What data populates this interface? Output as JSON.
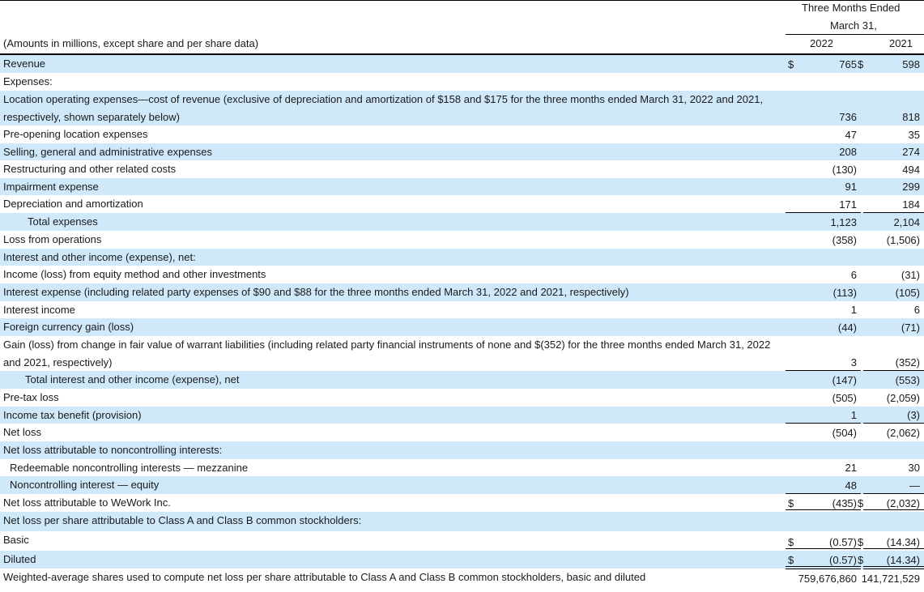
{
  "header": {
    "period_line1": "Three Months Ended",
    "period_line2": "March 31,",
    "col_2022": "2022",
    "col_2021": "2021",
    "amounts_note": "(Amounts in millions, except share and per share data)"
  },
  "rows": [
    {
      "label": "Revenue",
      "shaded": true,
      "h": 22,
      "d1": "$",
      "v2022": "765",
      "d2": "$",
      "v2021": "598"
    },
    {
      "label": "Expenses:",
      "shaded": false,
      "h": 22
    },
    {
      "label": "Location operating expenses—cost of revenue (exclusive of depreciation and amortization of $158 and $175 for the three months ended March 31, 2022 and 2021, respectively, shown separately below)",
      "shaded": true,
      "h": 43,
      "wrap": true,
      "v2022": "736",
      "v2021": "818"
    },
    {
      "label": "Pre-opening location expenses",
      "shaded": false,
      "h": 22,
      "v2022": "47",
      "v2021": "35"
    },
    {
      "label": "Selling, general and administrative expenses",
      "shaded": true,
      "h": 21,
      "v2022": "208",
      "v2021": "274"
    },
    {
      "label": "Restructuring and other related costs",
      "shaded": false,
      "h": 22,
      "v2022": "(130)",
      "v2021": "494"
    },
    {
      "label": "Impairment expense",
      "shaded": true,
      "h": 21,
      "v2022": "91",
      "v2021": "299"
    },
    {
      "label": "Depreciation and amortization",
      "shaded": false,
      "h": 22,
      "v2022": "171",
      "v2021": "184",
      "underline": "single"
    },
    {
      "label": "Total expenses",
      "indent": 30,
      "shaded": true,
      "h": 22,
      "v2022": "1,123",
      "v2021": "2,104"
    },
    {
      "label": "Loss from operations",
      "shaded": false,
      "h": 22,
      "v2022": "(358)",
      "v2021": "(1,506)"
    },
    {
      "label": "Interest and other income (expense), net:",
      "shaded": true,
      "h": 21
    },
    {
      "label": "Income (loss) from equity method and other investments",
      "shaded": false,
      "h": 22,
      "v2022": "6",
      "v2021": "(31)"
    },
    {
      "label": "Interest expense (including related party expenses of $90 and $88 for the three months ended March 31, 2022 and 2021, respectively)",
      "shaded": true,
      "h": 22,
      "v2022": "(113)",
      "v2021": "(105)"
    },
    {
      "label": "Interest income",
      "shaded": false,
      "h": 21,
      "v2022": "1",
      "v2021": "6"
    },
    {
      "label": "Foreign currency gain (loss)",
      "shaded": true,
      "h": 22,
      "v2022": "(44)",
      "v2021": "(71)"
    },
    {
      "label": "Gain (loss) from change in fair value of warrant liabilities (including related party financial instruments of none and $(352) for the three months ended March 31, 2022 and 2021, respectively)",
      "shaded": false,
      "h": 43,
      "wrap": true,
      "v2022": "3",
      "v2021": "(352)",
      "underline": "single"
    },
    {
      "label": "Total interest and other income (expense), net",
      "indent": 27,
      "shaded": true,
      "h": 22,
      "v2022": "(147)",
      "v2021": "(553)"
    },
    {
      "label": "Pre-tax loss",
      "shaded": false,
      "h": 22,
      "v2022": "(505)",
      "v2021": "(2,059)"
    },
    {
      "label": "Income tax benefit (provision)",
      "shaded": true,
      "h": 21,
      "v2022": "1",
      "v2021": "(3)",
      "underline": "single"
    },
    {
      "label": "Net loss",
      "shaded": false,
      "h": 22,
      "v2022": "(504)",
      "v2021": "(2,062)"
    },
    {
      "label": "Net loss attributable to noncontrolling interests:",
      "shaded": true,
      "h": 22
    },
    {
      "label": "Redeemable noncontrolling interests — mezzanine",
      "indent": 8,
      "shaded": false,
      "h": 21,
      "v2022": "21",
      "v2021": "30"
    },
    {
      "label": "Noncontrolling interest — equity",
      "indent": 8,
      "shaded": true,
      "h": 22,
      "v2022": "48",
      "v2021": "—",
      "underline": "single"
    },
    {
      "label": "Net loss attributable to WeWork Inc.",
      "shaded": false,
      "h": 22,
      "d1": "$",
      "v2022": "(435)",
      "d2": "$",
      "v2021": "(2,032)",
      "underline": "double"
    },
    {
      "label": "Net loss per share attributable to Class A and Class B common stockholders:",
      "shaded": true,
      "h": 24
    },
    {
      "label": "Basic",
      "shaded": false,
      "h": 24,
      "d1": "$",
      "v2022": "(0.57)",
      "d2": "$",
      "v2021": "(14.34)",
      "underline": "double"
    },
    {
      "label": "Diluted",
      "shaded": true,
      "h": 22,
      "d1": "$",
      "v2022": "(0.57)",
      "d2": "$",
      "v2021": "(14.34)",
      "underline": "double"
    },
    {
      "label": "Weighted-average shares used to compute net loss per share attributable to Class A and Class B common stockholders, basic and diluted",
      "shaded": false,
      "h": 23,
      "v2022": "759,676,860",
      "v2021": "141,721,529"
    }
  ]
}
